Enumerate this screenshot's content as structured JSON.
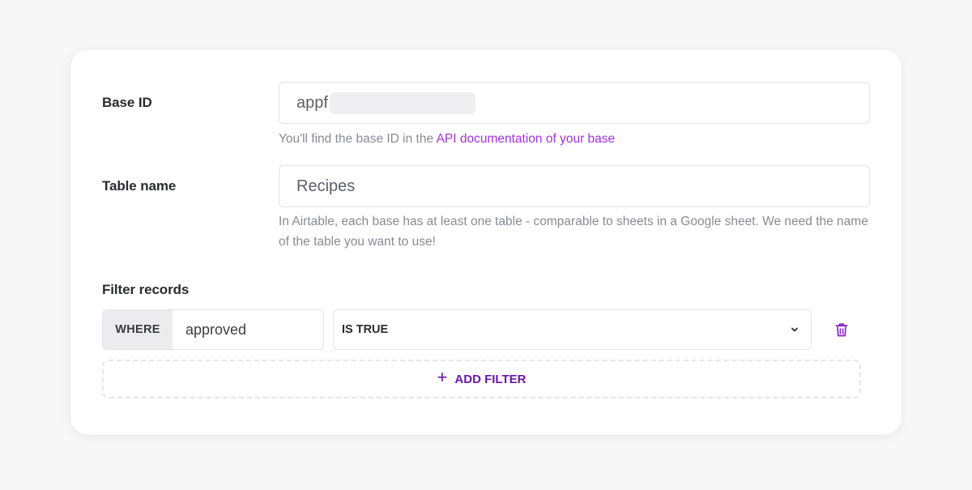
{
  "fields": {
    "base_id": {
      "label": "Base ID",
      "value_prefix": "appf",
      "hint_prefix": "You'll find the base ID in the ",
      "hint_link": "API documentation of your base"
    },
    "table_name": {
      "label": "Table name",
      "value": "Recipes",
      "hint": "In Airtable, each base has at least one table - comparable to sheets in a Google sheet. We need the name of the table you want to use!"
    }
  },
  "filters": {
    "label": "Filter records",
    "rows": [
      {
        "where_tag": "WHERE",
        "field": "approved",
        "condition": "IS TRUE",
        "delete_icon": "trash-icon"
      }
    ],
    "add_label": "ADD FILTER",
    "add_icon": "+"
  },
  "colors": {
    "accent_link": "#a430e0",
    "accent_button": "#6a16a8",
    "background": "#f7f7f8"
  }
}
